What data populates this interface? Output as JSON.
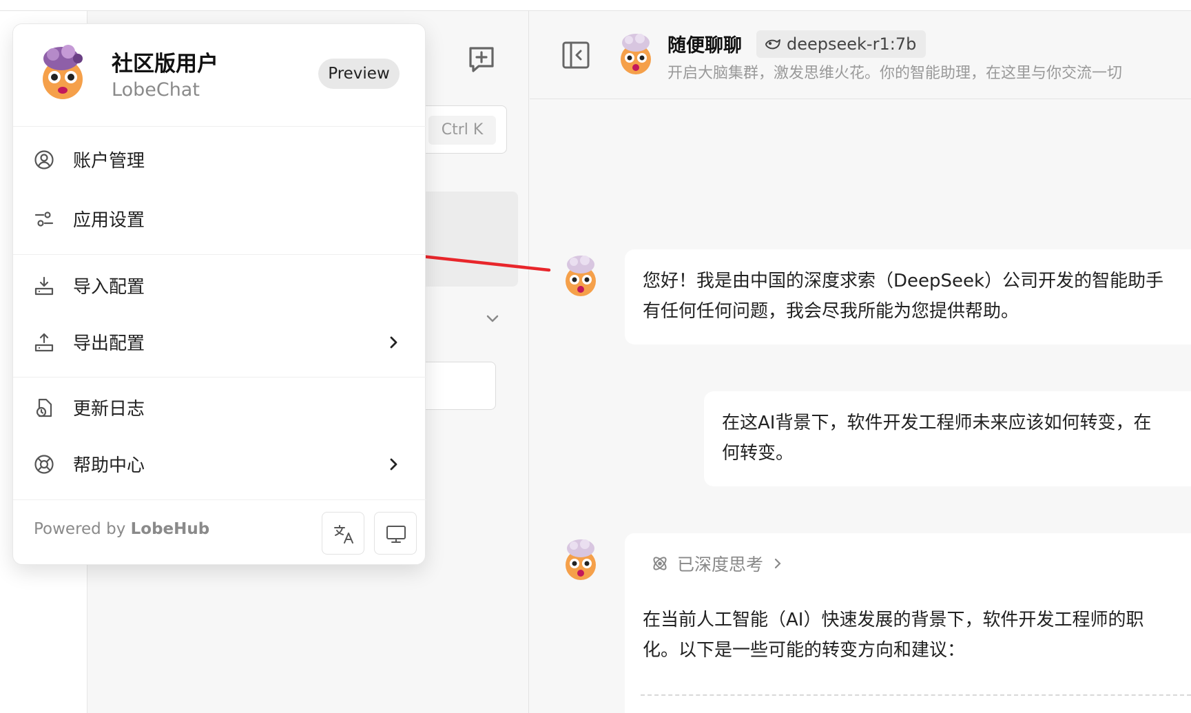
{
  "search": {
    "shortcut": "Ctrl K"
  },
  "chat": {
    "title": "随便聊聊",
    "model": "deepseek-r1:7b",
    "description": "开启大脑集群，激发思维火花。你的智能助理，在这里与你交流一切",
    "messages": [
      {
        "role": "assistant",
        "lines": [
          "您好！我是由中国的深度求索（DeepSeek）公司开发的智能助手",
          "有任何任何问题，我会尽我所能为您提供帮助。"
        ]
      },
      {
        "role": "user",
        "lines": [
          "在这AI背景下，软件开发工程师未来应该如何转变，在",
          "何转变。"
        ]
      },
      {
        "role": "assistant",
        "thinking_label": "已深度思考",
        "lines": [
          "在当前人工智能（AI）快速发展的背景下，软件开发工程师的职",
          "化。以下是一些可能的转变方向和建议："
        ]
      }
    ]
  },
  "menu": {
    "username": "社区版用户",
    "app_name": "LobeChat",
    "badge": "Preview",
    "items": [
      {
        "label": "账户管理",
        "icon": "user-circle-icon"
      },
      {
        "label": "应用设置",
        "icon": "settings-sliders-icon"
      },
      {
        "label": "导入配置",
        "icon": "import-icon"
      },
      {
        "label": "导出配置",
        "icon": "export-icon"
      },
      {
        "label": "更新日志",
        "icon": "changelog-icon"
      },
      {
        "label": "帮助中心",
        "icon": "help-lifebuoy-icon"
      }
    ],
    "powered_prefix": "Powered by",
    "powered_brand": "LobeHub",
    "footer_buttons": [
      "language-icon",
      "monitor-icon"
    ]
  },
  "annotation": {
    "color": "#e8262b"
  }
}
